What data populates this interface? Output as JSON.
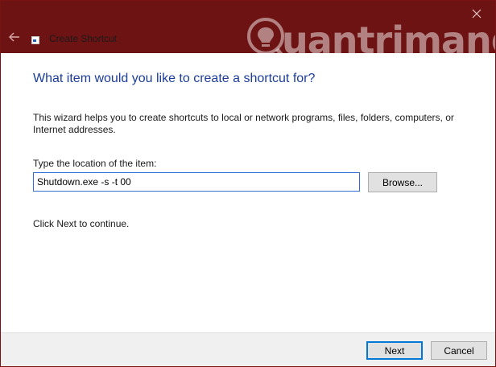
{
  "window": {
    "title": "Create Shortcut",
    "accent_color": "#6e1313"
  },
  "watermark": {
    "text": "uantrimang"
  },
  "icons": {
    "back": "back-arrow-icon",
    "close": "close-icon",
    "app": "shortcut-icon",
    "watermark_logo": "lightbulb-logo-icon"
  },
  "content": {
    "heading": "What item would you like to create a shortcut for?",
    "description": "This wizard helps you to create shortcuts to local or network programs, files, folders, computers, or Internet addresses.",
    "location_label": "Type the location of the item:",
    "location_value": "Shutdown.exe -s -t 00",
    "browse_label": "Browse...",
    "continue_text": "Click Next to continue."
  },
  "footer": {
    "next_label": "Next",
    "cancel_label": "Cancel"
  }
}
